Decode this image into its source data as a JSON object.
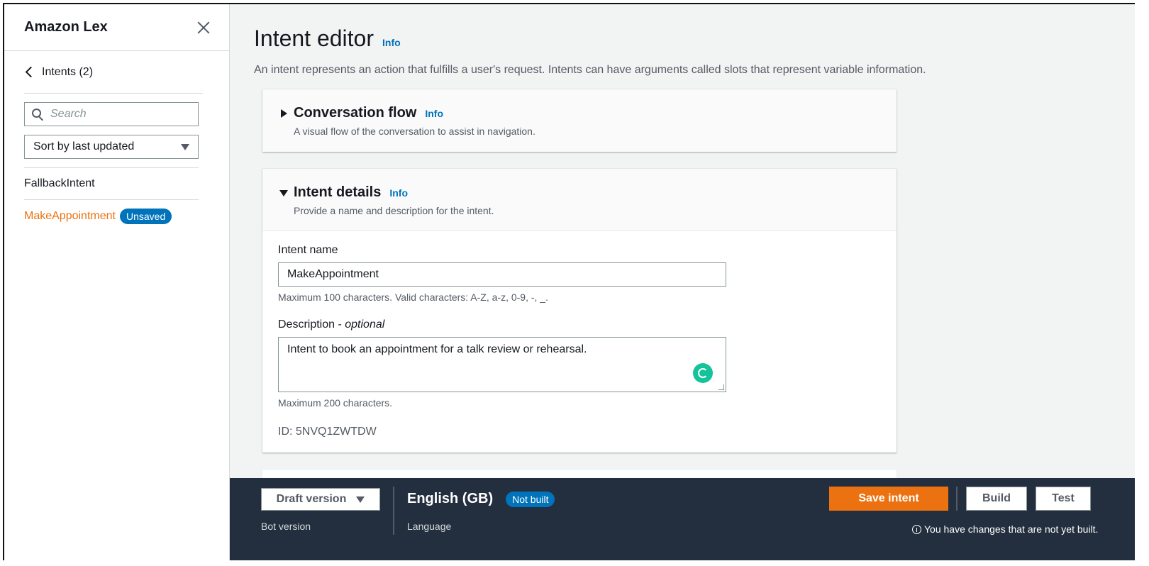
{
  "sidebar": {
    "title": "Amazon Lex",
    "back_label": "Intents (2)",
    "search_placeholder": "Search",
    "sort_label": "Sort by last updated",
    "intents": [
      {
        "label": "FallbackIntent"
      },
      {
        "label": "MakeAppointment",
        "badge": "Unsaved"
      }
    ]
  },
  "main": {
    "title": "Intent editor",
    "title_info": "Info",
    "description": "An intent represents an action that fulfills a user's request. Intents can have arguments called slots that represent variable information.",
    "conversation_flow": {
      "title": "Conversation flow",
      "info": "Info",
      "subtitle": "A visual flow of the conversation to assist in navigation."
    },
    "intent_details": {
      "title": "Intent details",
      "info": "Info",
      "subtitle": "Provide a name and description for the intent.",
      "name_label": "Intent name",
      "name_value": "MakeAppointment",
      "name_hint": "Maximum 100 characters. Valid characters: A-Z, a-z, 0-9, -, _.",
      "desc_label": "Description - ",
      "desc_label_optional": "optional",
      "desc_value": "Intent to book an appointment for a talk review or rehearsal.",
      "desc_hint": "Maximum 200 characters.",
      "id_line": "ID: 5NVQ1ZWTDW"
    }
  },
  "bottom_bar": {
    "version_button": "Draft version",
    "version_caption": "Bot version",
    "language": "English (GB)",
    "language_badge": "Not built",
    "language_caption": "Language",
    "save_button": "Save intent",
    "build_button": "Build",
    "test_button": "Test",
    "note": "You have changes that are not yet built."
  },
  "colors": {
    "accent": "#ec7211",
    "link": "#0073bb",
    "bar": "#232f3e"
  }
}
